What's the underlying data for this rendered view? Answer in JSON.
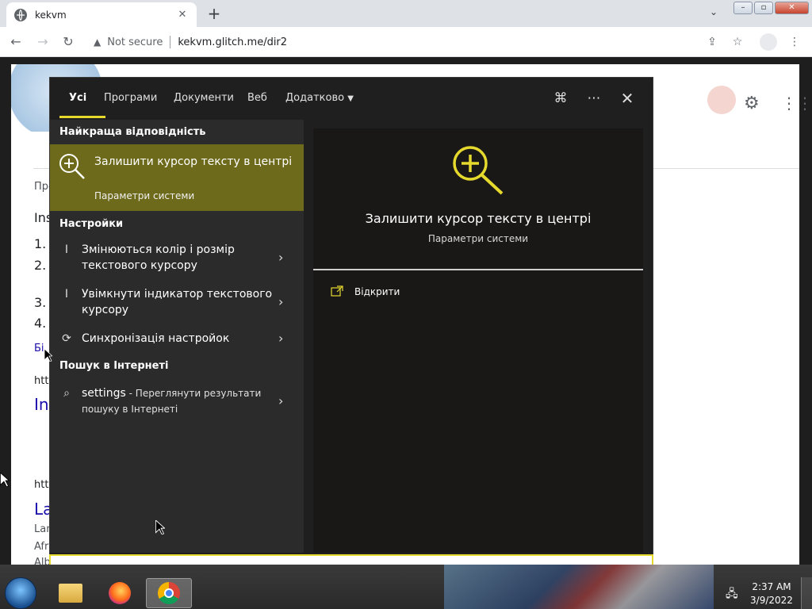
{
  "browser": {
    "tab_title": "kekvm",
    "security_label": "Not secure",
    "url": "kekvm.glitch.me/dir2"
  },
  "flyout": {
    "tabs": [
      {
        "label": "Усі"
      },
      {
        "label": "Програми"
      },
      {
        "label": "Документи"
      },
      {
        "label": "Веб"
      },
      {
        "label": "Додатково"
      }
    ],
    "best_match_header": "Найкраща відповідність",
    "best_match": {
      "title": "Залишити курсор тексту в центрі",
      "subtitle": "Параметри системи"
    },
    "settings_header": "Настройки",
    "settings_items": [
      {
        "label": "Змінюються колір і розмір текстового курсору"
      },
      {
        "label": "Увімкнути індикатор текстового курсору"
      },
      {
        "label": "Синхронізація настройок"
      }
    ],
    "web_header": "Пошук в Інтернеті",
    "web_item": {
      "query": "settings",
      "suffix": " - Переглянути результати пошуку в Інтернеті"
    },
    "preview": {
      "title": "Залишити курсор тексту в центрі",
      "subtitle": "Параметри системи",
      "open_label": "Відкрити"
    }
  },
  "background_page": {
    "fragments": [
      "Про",
      "Ins",
      "1.",
      "2.",
      "3.",
      "4.",
      "Бі",
      "http",
      "Ins",
      "http",
      "La",
      "Lan",
      "Afri",
      "Alb"
    ]
  },
  "taskbar": {
    "time": "2:37 AM",
    "date": "3/9/2022"
  },
  "colors": {
    "accent_yellow": "#e6d92d",
    "best_match_bg": "#6e6a1b",
    "flyout_bg": "#1f1f1f"
  }
}
